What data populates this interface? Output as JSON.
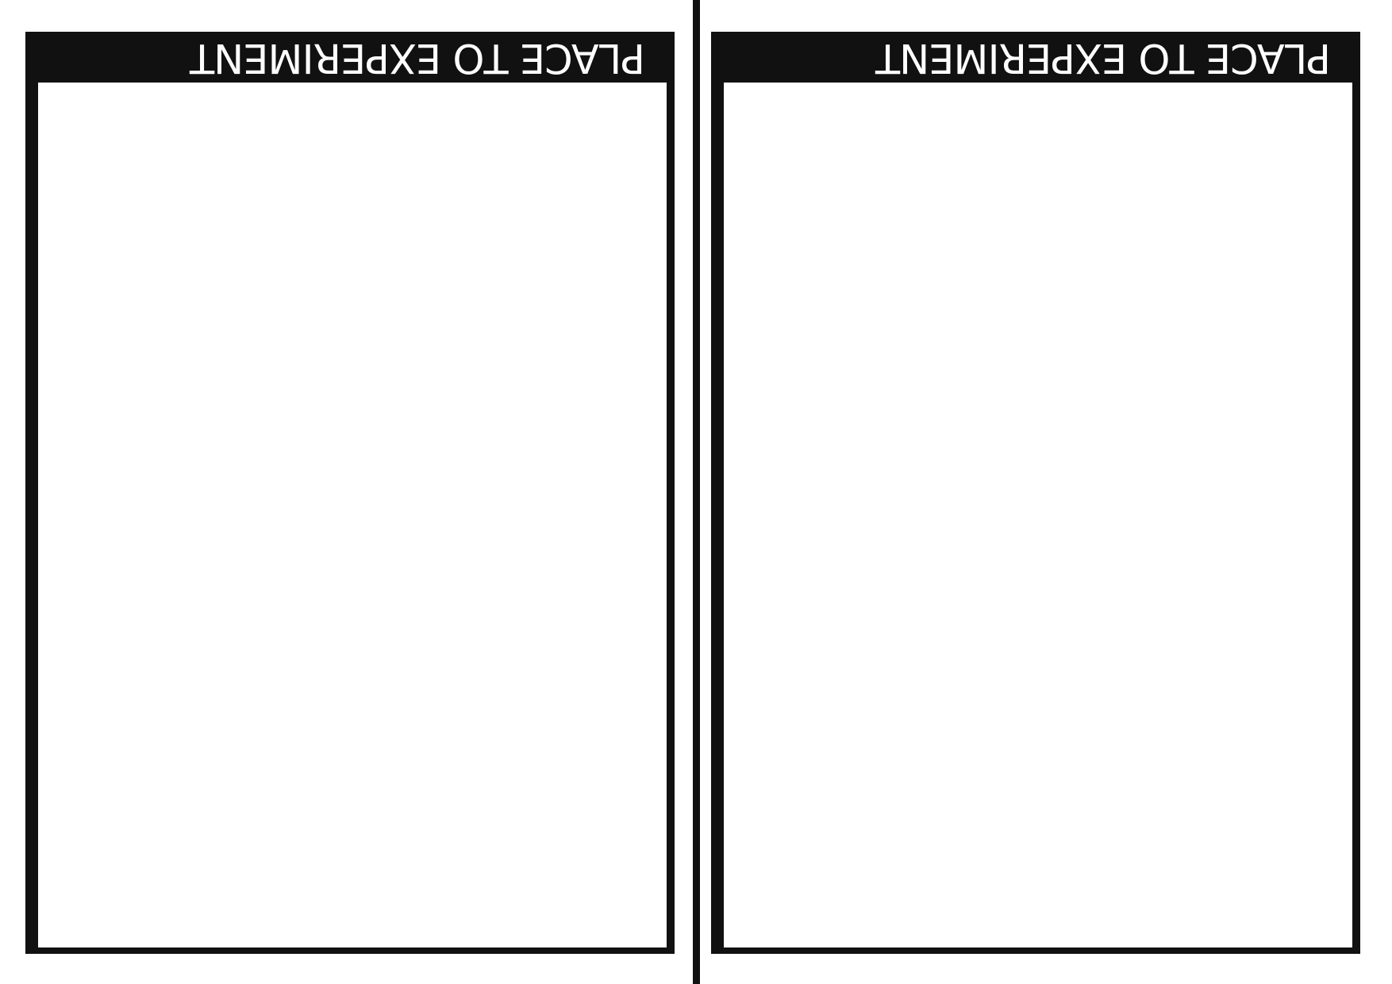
{
  "pages": [
    {
      "title": "PLACE TO EXPERIMENT"
    },
    {
      "title": "PLACE TO EXPERIMENT"
    }
  ],
  "colors": {
    "frame": "#111111",
    "background": "#ffffff",
    "title_text": "#ffffff"
  }
}
